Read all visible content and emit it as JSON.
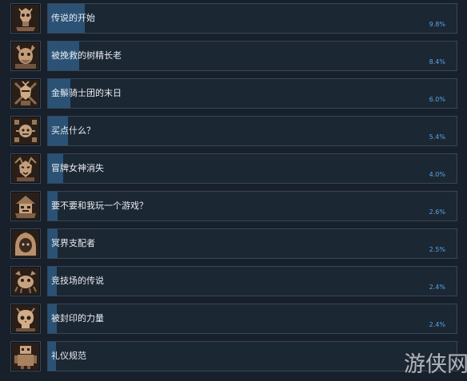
{
  "achievements": [
    {
      "title": "传说的开始",
      "percent_label": "9.8%",
      "percent": 9.8,
      "icon": "skull-knight-icon"
    },
    {
      "title": "被挽救的树精长老",
      "percent_label": "8.4%",
      "percent": 8.4,
      "icon": "treant-elder-icon"
    },
    {
      "title": "金鬃骑士团的末日",
      "percent_label": "6.0%",
      "percent": 6.0,
      "icon": "golden-mane-knight-icon"
    },
    {
      "title": "买点什么？",
      "percent_label": "5.4%",
      "percent": 5.4,
      "icon": "merchant-icon"
    },
    {
      "title": "冒牌女神消失",
      "percent_label": "4.0%",
      "percent": 4.0,
      "icon": "fake-goddess-icon"
    },
    {
      "title": "要不要和我玩一个游戏？",
      "percent_label": "2.6%",
      "percent": 2.6,
      "icon": "jester-icon"
    },
    {
      "title": "冥界支配者",
      "percent_label": "2.5%",
      "percent": 2.5,
      "icon": "hooded-reaper-icon"
    },
    {
      "title": "竞技场的传说",
      "percent_label": "2.4%",
      "percent": 2.4,
      "icon": "arena-crab-icon"
    },
    {
      "title": "被封印的力量",
      "percent_label": "2.4%",
      "percent": 2.4,
      "icon": "sealed-skull-icon"
    },
    {
      "title": "礼仪规范",
      "percent_label": "",
      "percent": 2.2,
      "icon": "etiquette-robot-icon"
    }
  ],
  "watermark": {
    "text": "游侠网"
  },
  "colors": {
    "background": "#18202b",
    "bar_track": "#1c2734",
    "bar_fill": "#2b5274",
    "percent_text": "#58a6e2",
    "title_text": "#e8edf2"
  }
}
